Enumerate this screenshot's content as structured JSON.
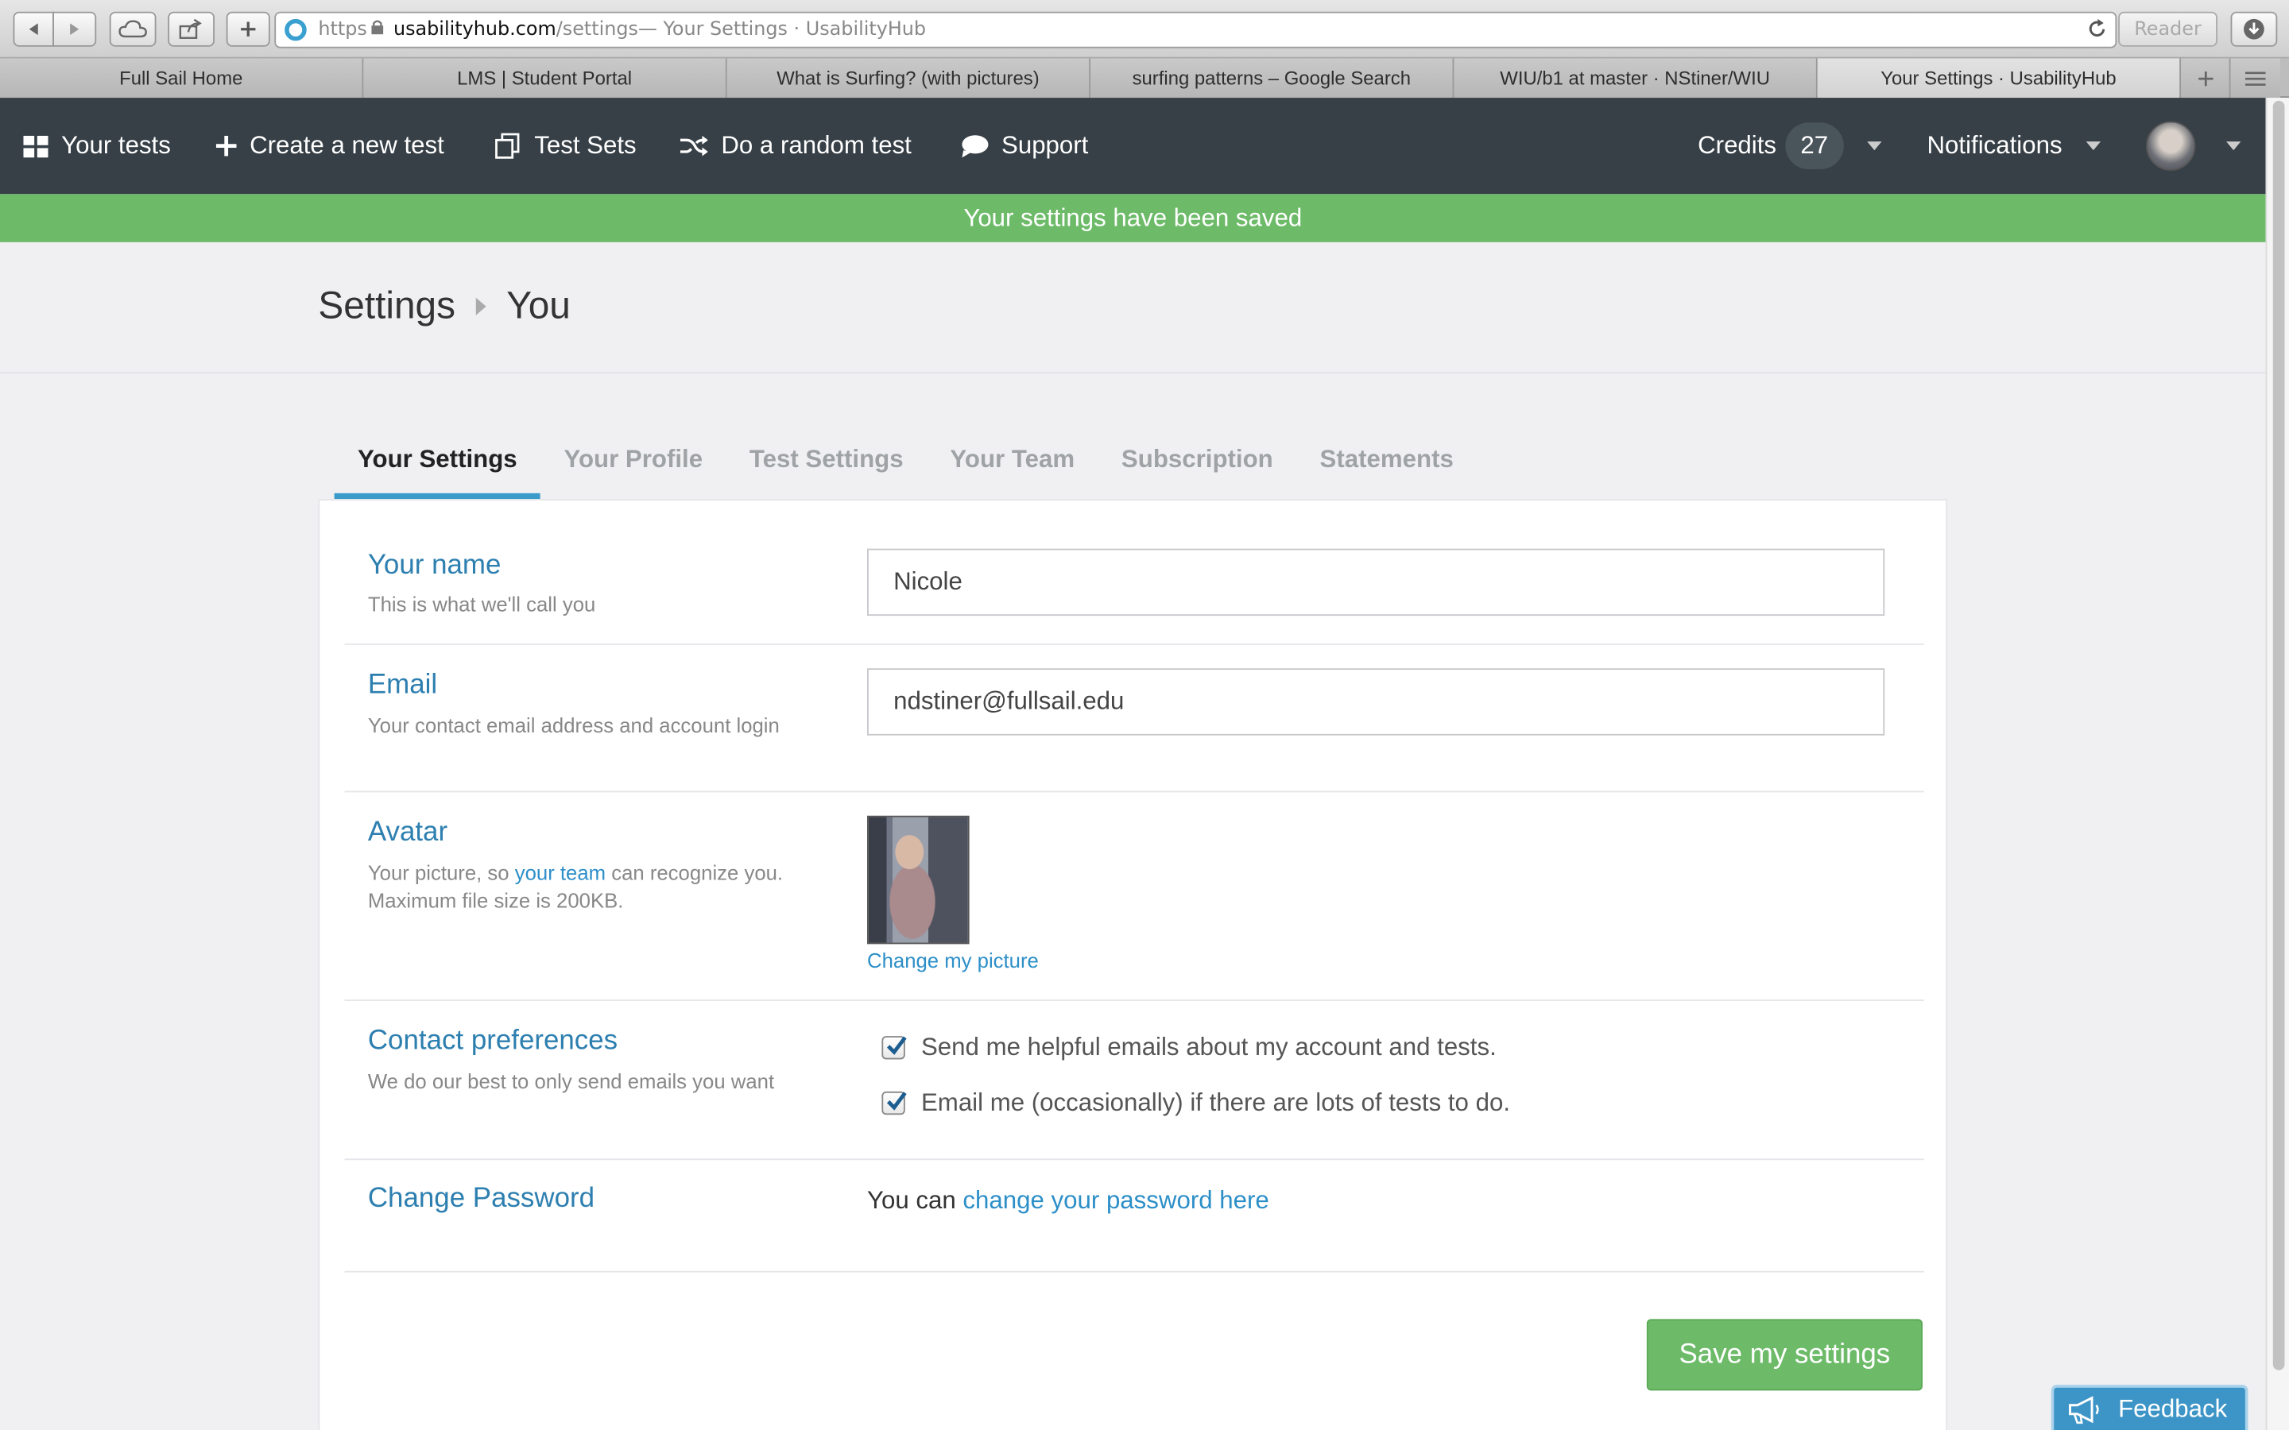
{
  "browser": {
    "url": {
      "scheme": "https",
      "domain": "usabilityhub.com",
      "path": "/settings",
      "title_suffix": " — Your Settings · UsabilityHub"
    },
    "reader_label": "Reader",
    "tabs": [
      {
        "label": "Full Sail Home"
      },
      {
        "label": "LMS | Student Portal"
      },
      {
        "label": "What is Surfing? (with pictures)"
      },
      {
        "label": "surfing patterns – Google Search"
      },
      {
        "label": "WIU/b1 at master · NStiner/WIU"
      },
      {
        "label": "Your Settings · UsabilityHub"
      }
    ]
  },
  "nav": {
    "your_tests": "Your tests",
    "create_test": "Create a new test",
    "test_sets": "Test Sets",
    "random_test": "Do a random test",
    "support": "Support",
    "credits_label": "Credits",
    "credits_count": "27",
    "notifications": "Notifications"
  },
  "flash": {
    "message": "Your settings have been saved",
    "color": "#6dbb69"
  },
  "breadcrumb": {
    "root": "Settings",
    "current": "You"
  },
  "settings_tabs": [
    {
      "label": "Your Settings",
      "active": true
    },
    {
      "label": "Your Profile"
    },
    {
      "label": "Test Settings"
    },
    {
      "label": "Your Team"
    },
    {
      "label": "Subscription"
    },
    {
      "label": "Statements"
    }
  ],
  "form": {
    "name": {
      "label": "Your name",
      "description": "This is what we'll call you",
      "value": "Nicole"
    },
    "email": {
      "label": "Email",
      "description": "Your contact email address and account login",
      "value": "ndstiner@fullsail.edu"
    },
    "avatar": {
      "label": "Avatar",
      "desc_prefix": "Your picture, so ",
      "desc_link": "your team",
      "desc_suffix": " can recognize you.",
      "desc_size": "Maximum file size is 200KB.",
      "change_link": "Change my picture"
    },
    "contact": {
      "label": "Contact preferences",
      "description": "We do our best to only send emails you want",
      "options": [
        {
          "label": "Send me helpful emails about my account and tests.",
          "checked": true
        },
        {
          "label": "Email me (occasionally) if there are lots of tests to do.",
          "checked": true
        }
      ]
    },
    "password": {
      "label": "Change Password",
      "text_prefix": "You can ",
      "link": "change your password here"
    },
    "save_button": "Save my settings"
  },
  "feedback_label": "Feedback",
  "colors": {
    "nav_bg": "#374047",
    "accent_blue": "#2d7fb0",
    "success_green": "#6dbb69"
  }
}
